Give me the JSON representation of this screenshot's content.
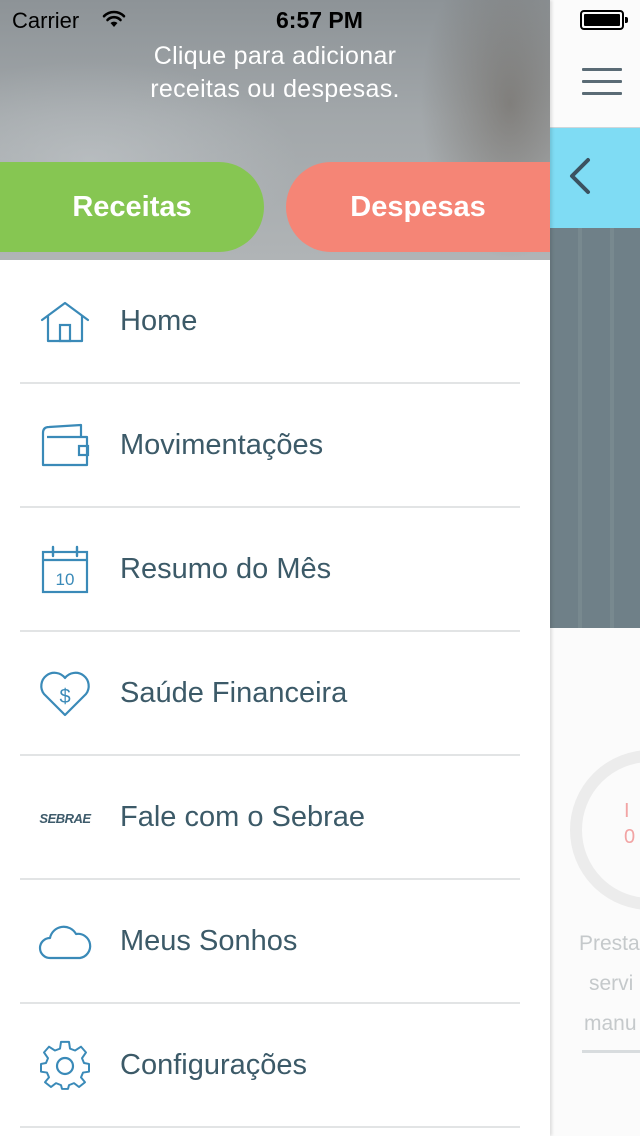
{
  "status_bar": {
    "carrier": "Carrier",
    "time": "6:57 PM"
  },
  "header": {
    "hint_line1": "Clique para adicionar",
    "hint_line2": "receitas ou despesas.",
    "receitas_label": "Receitas",
    "despesas_label": "Despesas"
  },
  "menu": {
    "items": [
      {
        "label": "Home",
        "icon": "home-icon"
      },
      {
        "label": "Movimentações",
        "icon": "wallet-icon"
      },
      {
        "label": "Resumo do Mês",
        "icon": "calendar-icon"
      },
      {
        "label": "Saúde Financeira",
        "icon": "heart-dollar-icon"
      },
      {
        "label": "Fale com o Sebrae",
        "icon": "sebrae-logo-icon"
      },
      {
        "label": "Meus Sonhos",
        "icon": "cloud-icon"
      },
      {
        "label": "Configurações",
        "icon": "gear-icon"
      }
    ],
    "calendar_day": "10",
    "sebrae_logo_text": "SEBRAE"
  },
  "background_screen": {
    "gauge_text_line1": "I",
    "gauge_text_line2": "0",
    "label_line1": "Presta",
    "label_line2": "servi",
    "label_line3": "manu"
  },
  "colors": {
    "receitas": "#86c652",
    "despesas": "#f58576",
    "accent_cyan": "#7fdcf4",
    "menu_text": "#3c5a68",
    "icon_blue": "#3a8ab8"
  }
}
